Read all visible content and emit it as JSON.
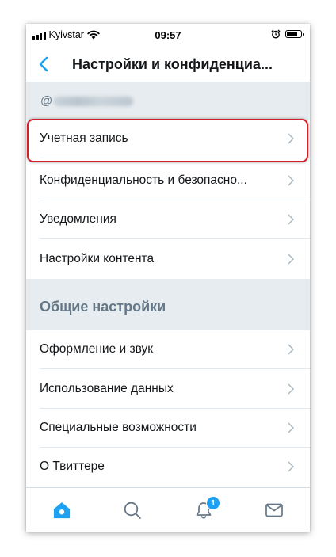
{
  "status_bar": {
    "carrier": "Kyivstar",
    "time": "09:57",
    "battery_level": 0.75
  },
  "nav": {
    "title": "Настройки и конфиденциа...",
    "back_icon": "chevron-left-icon"
  },
  "account": {
    "handle_prefix": "@"
  },
  "account_items": [
    {
      "label": "Учетная запись"
    },
    {
      "label": "Конфиденциальность и безопасно..."
    },
    {
      "label": "Уведомления"
    },
    {
      "label": "Настройки контента"
    }
  ],
  "general": {
    "title": "Общие настройки",
    "items": [
      {
        "label": "Оформление и звук"
      },
      {
        "label": "Использование данных"
      },
      {
        "label": "Специальные возможности"
      },
      {
        "label": "О Твиттере"
      }
    ]
  },
  "tab_bar": {
    "tabs": [
      {
        "icon": "home-icon"
      },
      {
        "icon": "search-icon"
      },
      {
        "icon": "notifications-icon",
        "badge": "1"
      },
      {
        "icon": "messages-icon"
      }
    ]
  },
  "colors": {
    "accent": "#1da1f2",
    "highlight": "#d3202a",
    "section_bg": "#e6ecf0"
  }
}
